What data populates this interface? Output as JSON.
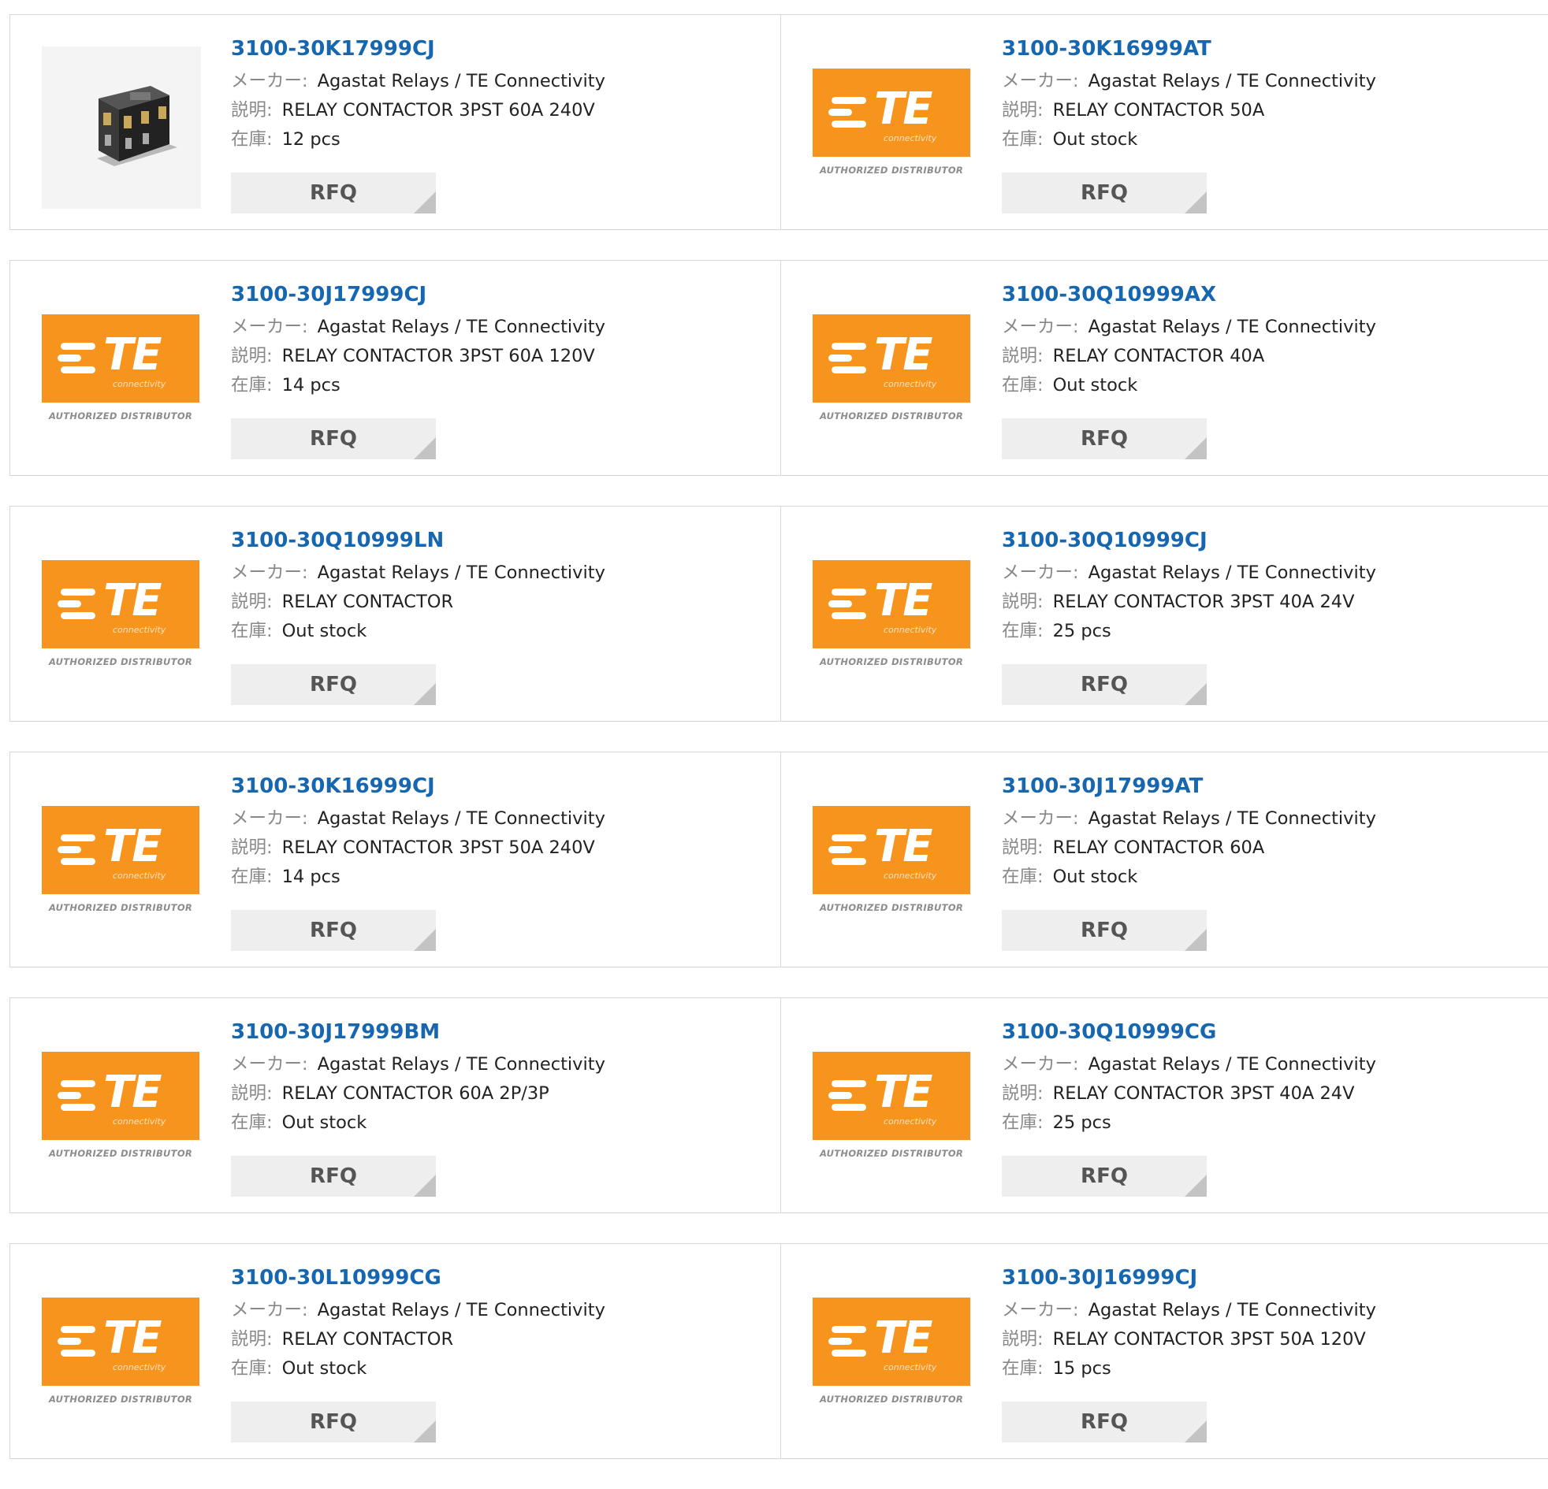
{
  "labels": {
    "maker": "メーカー:",
    "description": "説明:",
    "stock": "在庫:",
    "rfq": "RFQ"
  },
  "te_logo": {
    "word": "TE",
    "sub": "connectivity",
    "distributor": "AUTHORIZED DISTRIBUTOR"
  },
  "colors": {
    "part_link": "#1766b0",
    "te_orange": "#f7941d",
    "rfq_bg": "#eeeeee"
  },
  "products": [
    {
      "part": "3100-30K17999CJ",
      "maker": "Agastat Relays / TE Connectivity",
      "description": "RELAY CONTACTOR 3PST 60A 240V",
      "stock": "12 pcs",
      "image": "relay-contactor-photo"
    },
    {
      "part": "3100-30K16999AT",
      "maker": "Agastat Relays / TE Connectivity",
      "description": "RELAY CONTACTOR 50A",
      "stock": "Out stock",
      "image": "te-logo"
    },
    {
      "part": "3100-30J17999CJ",
      "maker": "Agastat Relays / TE Connectivity",
      "description": "RELAY CONTACTOR 3PST 60A 120V",
      "stock": "14 pcs",
      "image": "te-logo"
    },
    {
      "part": "3100-30Q10999AX",
      "maker": "Agastat Relays / TE Connectivity",
      "description": "RELAY CONTACTOR 40A",
      "stock": "Out stock",
      "image": "te-logo"
    },
    {
      "part": "3100-30Q10999LN",
      "maker": "Agastat Relays / TE Connectivity",
      "description": "RELAY CONTACTOR",
      "stock": "Out stock",
      "image": "te-logo"
    },
    {
      "part": "3100-30Q10999CJ",
      "maker": "Agastat Relays / TE Connectivity",
      "description": "RELAY CONTACTOR 3PST 40A 24V",
      "stock": "25 pcs",
      "image": "te-logo"
    },
    {
      "part": "3100-30K16999CJ",
      "maker": "Agastat Relays / TE Connectivity",
      "description": "RELAY CONTACTOR 3PST 50A 240V",
      "stock": "14 pcs",
      "image": "te-logo"
    },
    {
      "part": "3100-30J17999AT",
      "maker": "Agastat Relays / TE Connectivity",
      "description": "RELAY CONTACTOR 60A",
      "stock": "Out stock",
      "image": "te-logo"
    },
    {
      "part": "3100-30J17999BM",
      "maker": "Agastat Relays / TE Connectivity",
      "description": "RELAY CONTACTOR 60A 2P/3P",
      "stock": "Out stock",
      "image": "te-logo"
    },
    {
      "part": "3100-30Q10999CG",
      "maker": "Agastat Relays / TE Connectivity",
      "description": "RELAY CONTACTOR 3PST 40A 24V",
      "stock": "25 pcs",
      "image": "te-logo"
    },
    {
      "part": "3100-30L10999CG",
      "maker": "Agastat Relays / TE Connectivity",
      "description": "RELAY CONTACTOR",
      "stock": "Out stock",
      "image": "te-logo"
    },
    {
      "part": "3100-30J16999CJ",
      "maker": "Agastat Relays / TE Connectivity",
      "description": "RELAY CONTACTOR 3PST 50A 120V",
      "stock": "15 pcs",
      "image": "te-logo"
    }
  ]
}
